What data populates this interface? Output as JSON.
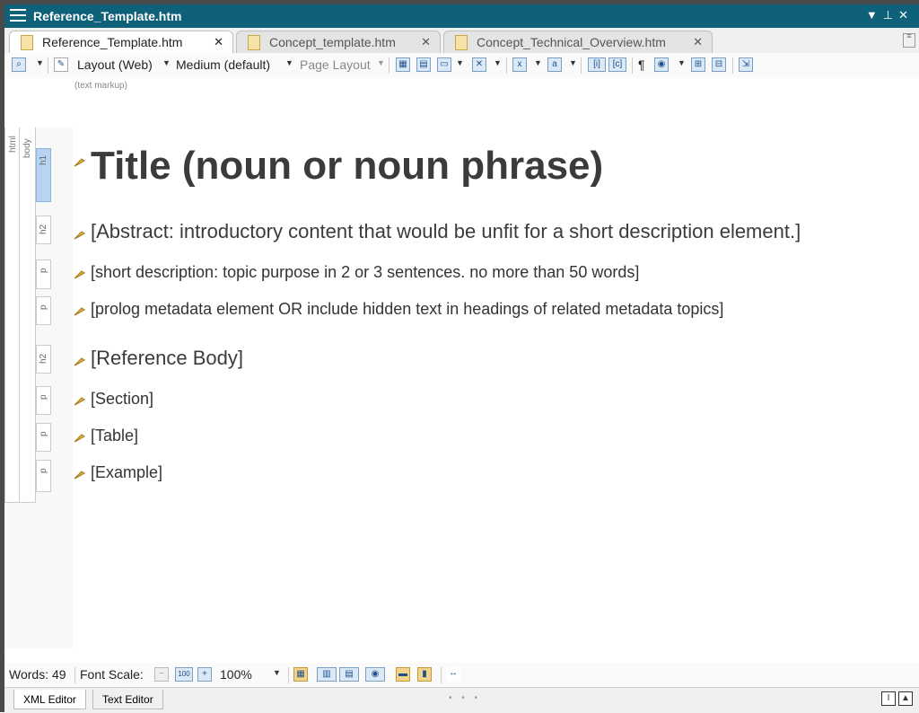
{
  "window": {
    "title": "Reference_Template.htm"
  },
  "tabs": [
    {
      "label": "Reference_Template.htm"
    },
    {
      "label": "Concept_template.htm"
    },
    {
      "label": "Concept_Technical_Overview.htm"
    }
  ],
  "toolbar": {
    "layout": "Layout (Web)",
    "size": "Medium (default)",
    "page_layout": "Page Layout",
    "pilcrow": "¶"
  },
  "subhint": "(text markup)",
  "structure": {
    "html": "html",
    "body": "body",
    "tags": [
      "h1",
      "h2",
      "p",
      "p",
      "h2",
      "p",
      "p",
      "p"
    ]
  },
  "document": {
    "title": "Title (noun or noun phrase)",
    "abstract": "[Abstract: introductory content that would be unfit for a short description element.]",
    "shortdesc": "[short description: topic purpose in 2 or 3 sentences. no more than 50 words]",
    "prolog": "[prolog metadata element OR include hidden text in headings of related metadata topics]",
    "refbody": "[Reference Body]",
    "section": "[Section]",
    "table": "[Table]",
    "example": "[Example]"
  },
  "status": {
    "words": "Words: 49",
    "font_scale_label": "Font Scale:",
    "zoom": "100%"
  },
  "bottom_tabs": [
    "XML Editor",
    "Text Editor"
  ],
  "colors": {
    "titlebar": "#0f6079",
    "selected_tag": "#b7d5f2"
  }
}
